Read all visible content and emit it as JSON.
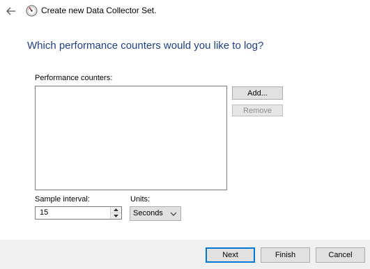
{
  "titlebar": {
    "title": "Create new Data Collector Set.",
    "back_icon": "back-arrow-icon",
    "app_icon": "performance-monitor-icon"
  },
  "main": {
    "heading": "Which performance counters would you like to log?",
    "counters_label": "Performance counters:",
    "counters_items": [],
    "add_label": "Add...",
    "remove_label": "Remove",
    "sample_interval_label": "Sample interval:",
    "sample_interval_value": "15",
    "units_label": "Units:",
    "units_value": "Seconds"
  },
  "footer": {
    "next_label": "Next",
    "finish_label": "Finish",
    "cancel_label": "Cancel"
  },
  "colors": {
    "heading": "#1e3f8a",
    "default_button_border": "#0078d7",
    "footer_bg": "#f0f0f0"
  }
}
